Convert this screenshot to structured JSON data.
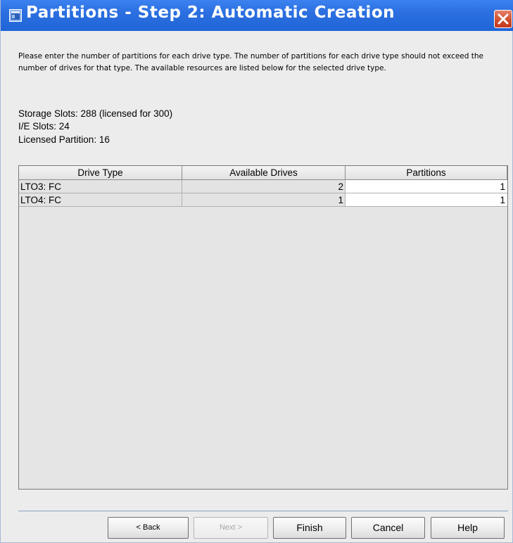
{
  "window": {
    "title": "Partitions - Step 2: Automatic Creation",
    "title_bar_color": "#2b6fe0",
    "close_button_color": "#cf4a2c"
  },
  "intro_text": "Please enter the number of partitions for each drive type. The number of partitions for each drive type should not exceed the number of drives for that type. The available resources are listed below for the selected drive type.",
  "resources": {
    "storage_slots": "Storage Slots: 288 (licensed for 300)",
    "ie_slots": "I/E Slots: 24",
    "licensed_partition": "Licensed Partition: 16"
  },
  "table": {
    "columns": [
      "Drive Type",
      "Available Drives",
      "Partitions"
    ],
    "rows": [
      {
        "drive_type": "LTO3: FC",
        "available_drives": "2",
        "partitions": "1"
      },
      {
        "drive_type": "LTO4: FC",
        "available_drives": "1",
        "partitions": "1"
      }
    ]
  },
  "buttons": {
    "back": "< Back",
    "next": "Next >",
    "finish": "Finish",
    "cancel": "Cancel",
    "help": "Help"
  },
  "icons": {
    "title": "window-app-icon",
    "close": "close-icon"
  }
}
